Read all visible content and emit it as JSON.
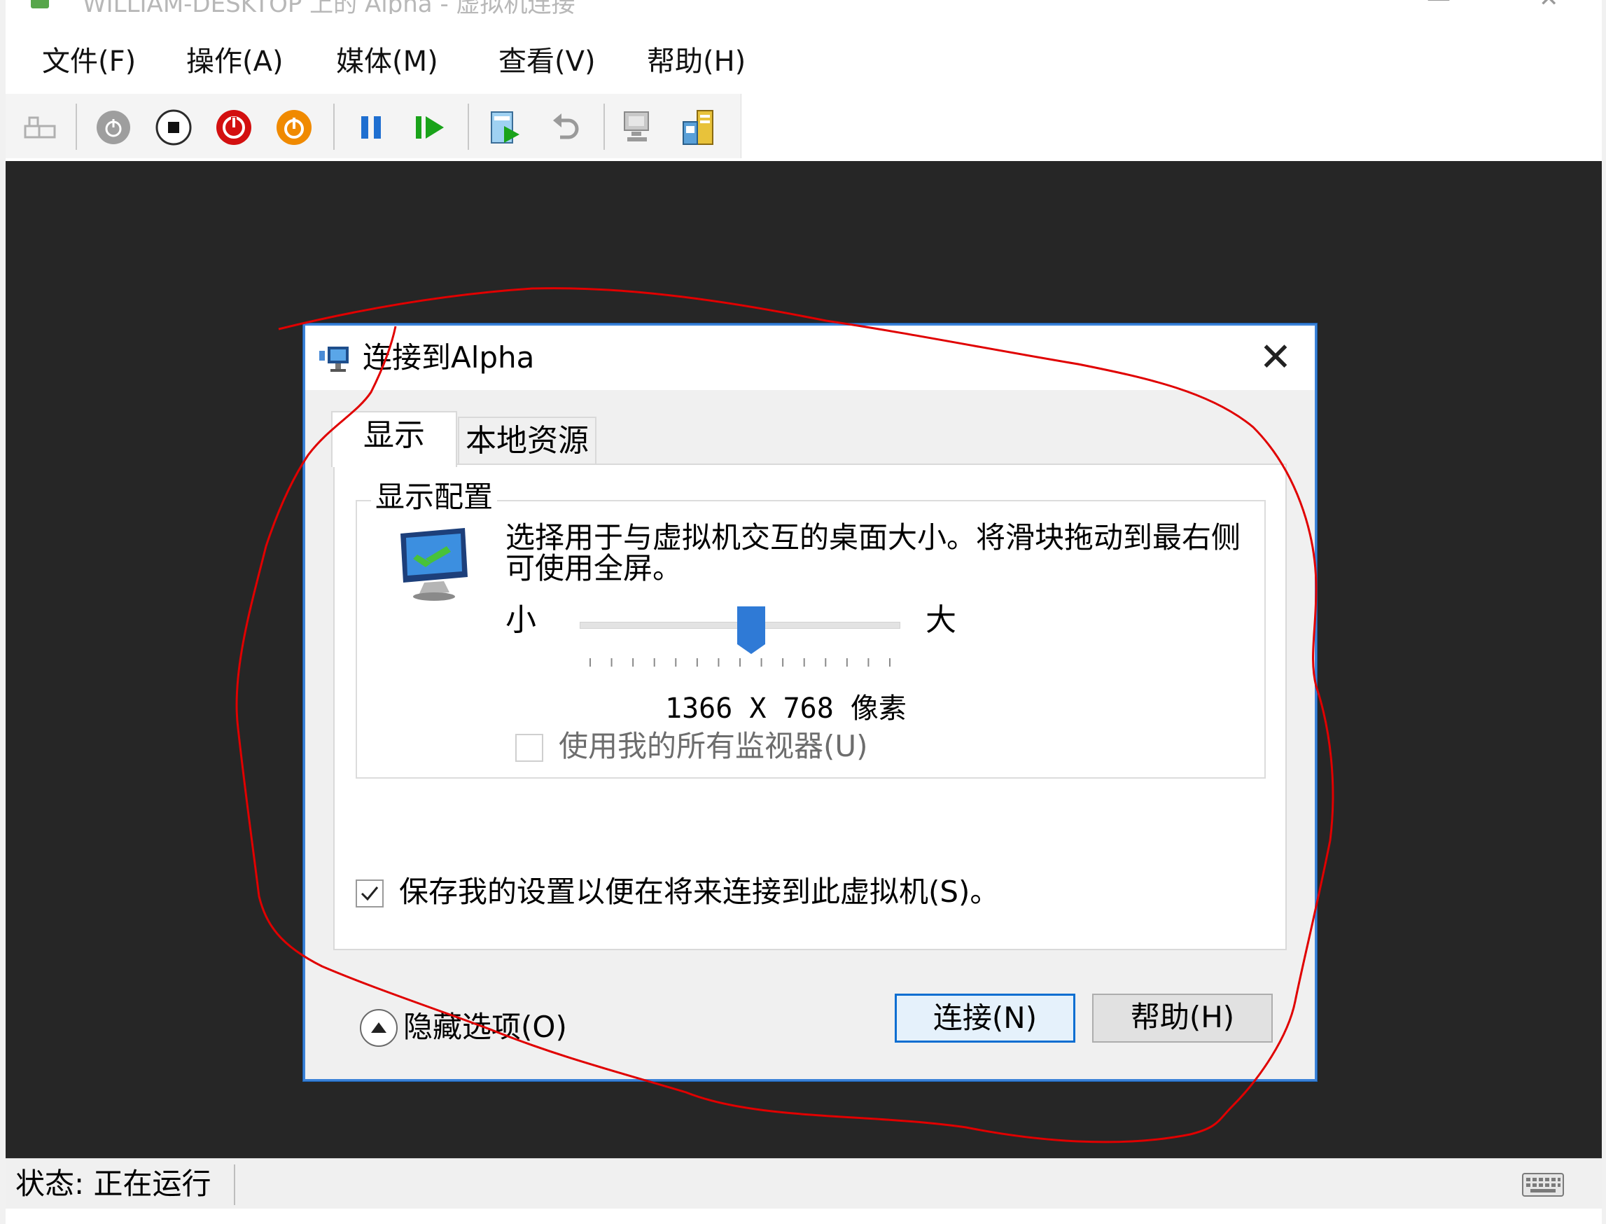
{
  "window": {
    "title": "WILLIAM-DESKTOP 上的 Alpha - 虚拟机连接"
  },
  "menu": {
    "items": [
      "文件(F)",
      "操作(A)",
      "媒体(M)",
      "查看(V)",
      "帮助(H)"
    ]
  },
  "toolbar": {
    "buttons": [
      "ctrl-alt-del-icon",
      "start-icon",
      "turn-off-icon",
      "shut-down-icon",
      "save-icon",
      "pause-icon",
      "resume-icon",
      "checkpoint-icon",
      "revert-icon",
      "enhanced-session-icon",
      "share-icon"
    ]
  },
  "dialog": {
    "title": "连接到Alpha",
    "close_symbol": "✕",
    "tabs": [
      {
        "label": "显示",
        "active": true
      },
      {
        "label": "本地资源",
        "active": false
      }
    ],
    "group_label": "显示配置",
    "description": "选择用于与虚拟机交互的桌面大小。将滑块拖动到最右侧可使用全屏。",
    "slider": {
      "min_label": "小",
      "max_label": "大",
      "position_fraction": 0.54,
      "tick_count": 15,
      "accent_color": "#2f7ad6"
    },
    "resolution": {
      "value": "1366 X 768",
      "unit": "像素"
    },
    "use_all_monitors": {
      "label": "使用我的所有监视器(U)",
      "checked": false,
      "enabled": false
    },
    "save_settings": {
      "label": "保存我的设置以便在将来连接到此虚拟机(S)。",
      "checked": true
    },
    "hide_options_label": "隐藏选项(O)",
    "connect_button": "连接(N)",
    "help_button": "帮助(H)"
  },
  "statusbar": {
    "status": "状态: 正在运行"
  },
  "colors": {
    "vm_background": "#262626",
    "dialog_border": "#3b82d8",
    "annotation": "#e00000"
  }
}
